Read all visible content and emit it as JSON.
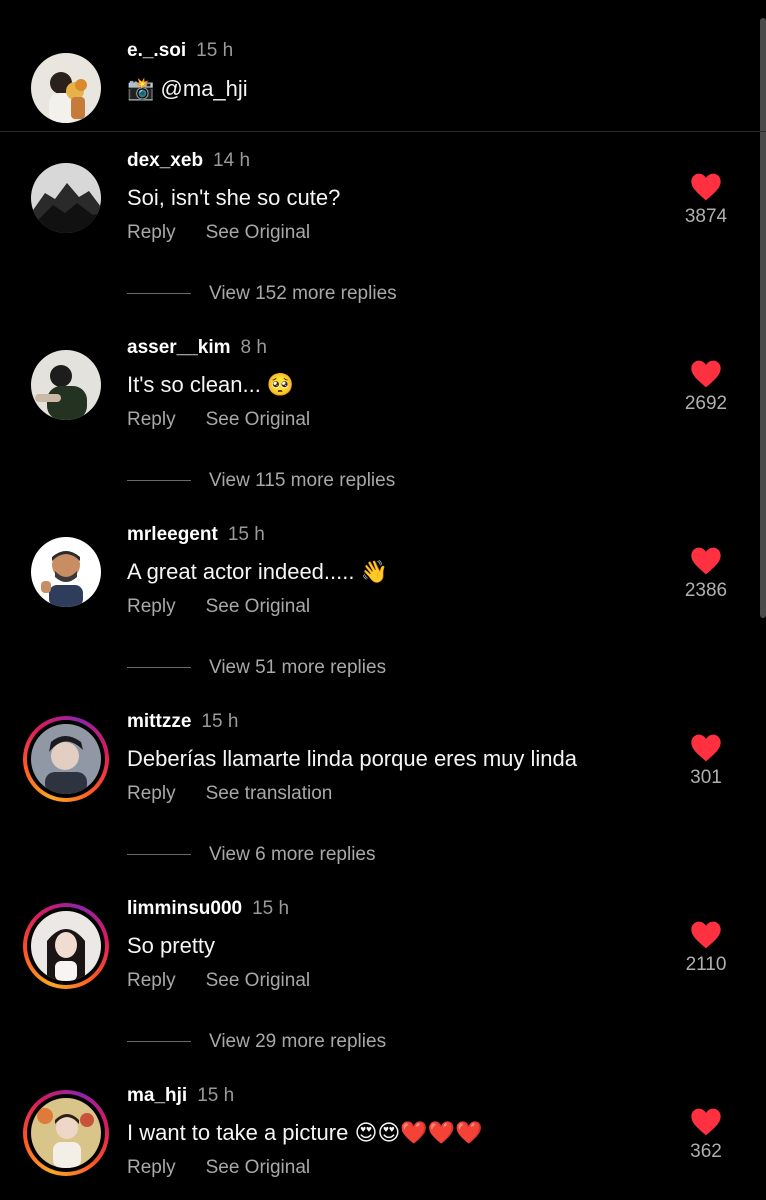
{
  "caption": {
    "username": "e._.soi",
    "time": "15 h",
    "camera_emoji": "📸",
    "mention": "@ma_hji"
  },
  "comments": [
    {
      "username": "dex_xeb",
      "time": "14 h",
      "text": "Soi, isn't she so cute?",
      "reply": "Reply",
      "see": "See Original",
      "likes": "3874",
      "more": "View 152 more replies"
    },
    {
      "username": "asser__kim",
      "time": "8 h",
      "text": "It's so clean... 🥺",
      "reply": "Reply",
      "see": "See Original",
      "likes": "2692",
      "more": "View 115 more replies"
    },
    {
      "username": "mrleegent",
      "time": "15 h",
      "text": "A great actor indeed..... 👋",
      "reply": "Reply",
      "see": "See Original",
      "likes": "2386",
      "more": "View 51 more replies"
    },
    {
      "username": "mittzze",
      "time": "15 h",
      "text": "Deberías llamarte linda porque eres muy linda",
      "reply": "Reply",
      "see": "See translation",
      "likes": "301",
      "more": "View 6 more replies"
    },
    {
      "username": "limminsu000",
      "time": "15 h",
      "text": "So pretty",
      "reply": "Reply",
      "see": "See Original",
      "likes": "2110",
      "more": "View 29 more replies"
    },
    {
      "username": "ma_hji",
      "time": "15 h",
      "text": "I want to take a picture 😍😍❤️❤️❤️",
      "reply": "Reply",
      "see": "See Original",
      "likes": "362"
    }
  ],
  "colors": {
    "background": "#000000",
    "heart": "#ff3040",
    "secondary_text": "#a8a8a8"
  }
}
